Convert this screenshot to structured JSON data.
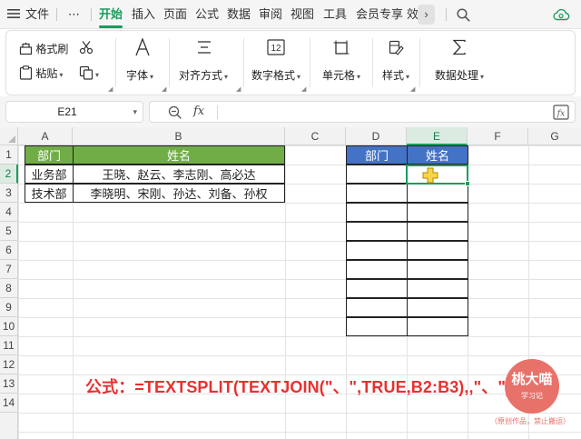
{
  "menu": {
    "file": "文件",
    "more": "⋯",
    "tabs": [
      "开始",
      "插入",
      "页面",
      "公式",
      "数据",
      "审阅",
      "视图",
      "工具",
      "会员专享",
      "效"
    ]
  },
  "ribbon": {
    "format_painter": "格式刷",
    "paste": "粘贴",
    "font": "字体",
    "alignment": "对齐方式",
    "number_format": "数字格式",
    "cell": "单元格",
    "styles": "样式",
    "data_processing": "数据处理"
  },
  "formula_bar": {
    "name_box": "E21",
    "fx": "fx",
    "content": ""
  },
  "grid": {
    "columns": [
      "A",
      "B",
      "C",
      "D",
      "E",
      "F",
      "G"
    ],
    "rows": [
      "1",
      "2",
      "3",
      "4",
      "5",
      "6",
      "7",
      "8",
      "9",
      "10",
      "11",
      "12",
      "13",
      "14"
    ],
    "source_table": {
      "headers": [
        "部门",
        "姓名"
      ],
      "rows": [
        [
          "业务部",
          "王晓、赵云、李志刚、高必达"
        ],
        [
          "技术部",
          "李晓明、宋刚、孙达、刘备、孙权"
        ]
      ]
    },
    "result_table": {
      "headers": [
        "部门",
        "姓名"
      ]
    },
    "selected_cell": "E2"
  },
  "colors": {
    "accent": "#1a9c5b",
    "header_green": "#70ad47",
    "header_blue": "#4472c4",
    "formula_red": "#e8312f",
    "stamp": "#e8716a"
  },
  "overlay": {
    "formula_text": "公式：=TEXTSPLIT(TEXTJOIN(\"、\",TRUE,B2:B3),,\"、\")",
    "stamp_title": "桃大喵",
    "stamp_sub": "学习记",
    "credit": "（原创作品，禁止搬运）"
  }
}
